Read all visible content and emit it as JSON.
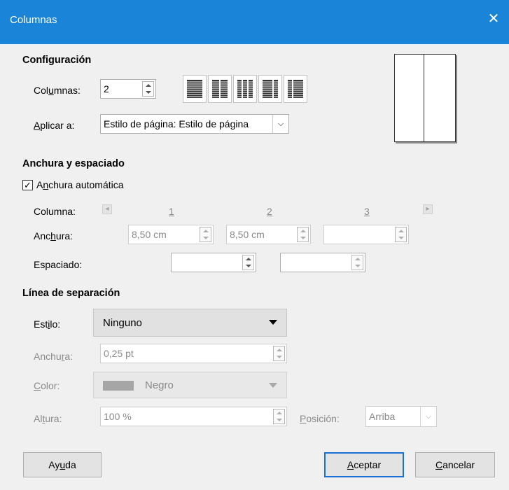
{
  "window": {
    "title": "Columnas",
    "close_icon": "close-icon"
  },
  "config": {
    "heading": "Configuración",
    "columns_label_pre": "Col",
    "columns_label_key": "u",
    "columns_label_post": "mnas:",
    "columns_value": "2",
    "apply_label_key": "A",
    "apply_label_post": "plicar a:",
    "apply_value": "Estilo de página: Estilo de página"
  },
  "width_spacing": {
    "heading": "Anchura y espaciado",
    "auto_pre": "A",
    "auto_key": "n",
    "auto_post": "chura automática",
    "auto_checked": true,
    "column_label": "Columna:",
    "col_numbers": [
      "1",
      "2",
      "3"
    ],
    "width_label_pre": "Anc",
    "width_label_key": "h",
    "width_label_post": "ura:",
    "widths": [
      "8,50 cm",
      "8,50 cm",
      ""
    ],
    "spacing_label": "Espaciado:",
    "spacings": [
      "",
      ""
    ]
  },
  "separator": {
    "heading": "Línea de separación",
    "style_label_pre": "Est",
    "style_label_key": "i",
    "style_label_post": "lo:",
    "style_value": "Ninguno",
    "width_label_pre": "Anchu",
    "width_label_key": "r",
    "width_label_post": "a:",
    "width_value": "0,25 pt",
    "color_label_key": "C",
    "color_label_post": "olor:",
    "color_value": "Negro",
    "color_swatch": "#a6a6a6",
    "height_label_pre": "Al",
    "height_label_key": "t",
    "height_label_post": "ura:",
    "height_value": "100 %",
    "position_label_key": "P",
    "position_label_post": "osición:",
    "position_value": "Arriba"
  },
  "buttons": {
    "help_pre": "Ay",
    "help_key": "u",
    "help_post": "da",
    "ok_key": "A",
    "ok_post": "ceptar",
    "cancel_key": "C",
    "cancel_post": "ancelar"
  },
  "colors": {
    "titlebar": "#1a84d9",
    "primary_border": "#1a6fd2"
  }
}
